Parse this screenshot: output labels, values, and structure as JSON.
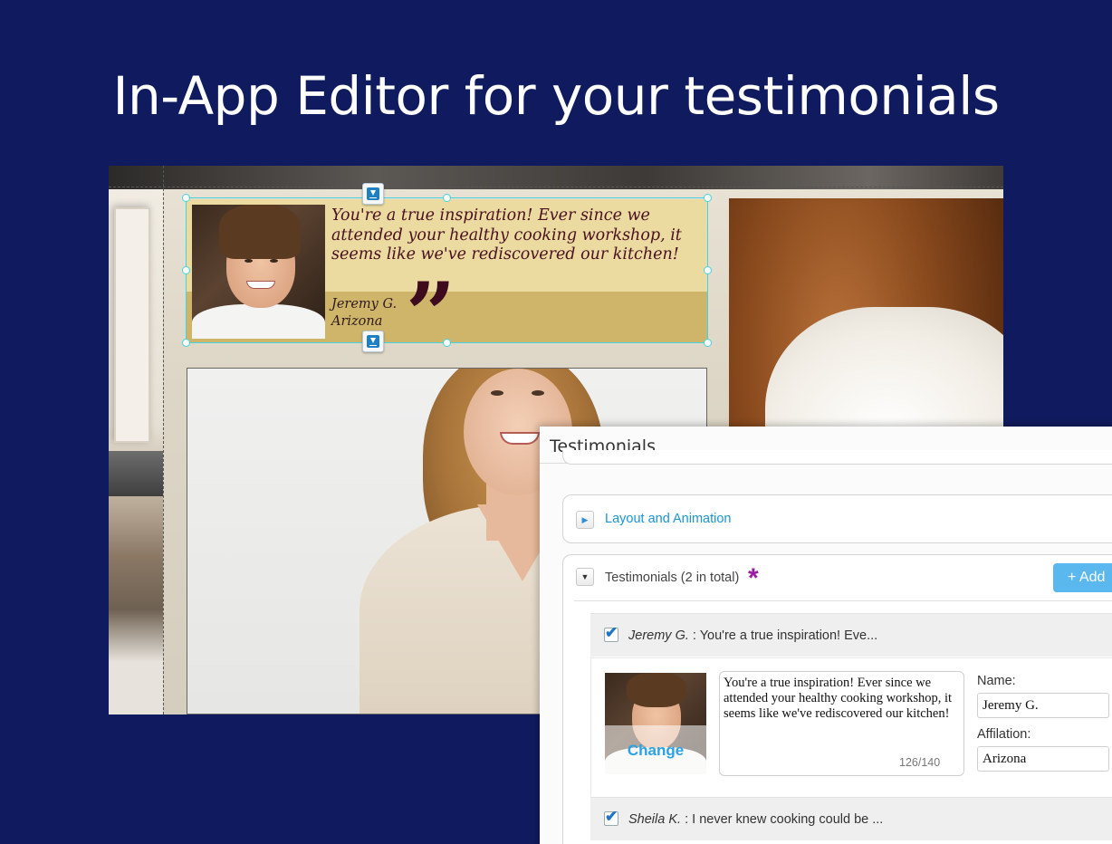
{
  "headline": "In-App Editor for your testimonials",
  "preview": {
    "testimonial": {
      "quote": "You're a true inspiration! Ever since we attended your healthy cooking workshop, it seems like we've rediscovered our kitchen!",
      "name": "Jeremy G.",
      "affiliation": "Arizona",
      "quote_mark": "”"
    }
  },
  "panel": {
    "title": "Testimonials",
    "sections": {
      "layout": {
        "label": "Layout and Animation",
        "toggle": "▶"
      },
      "testimonials": {
        "label": "Testimonials (2 in total)",
        "toggle": "▼",
        "required_mark": "*",
        "add_button": "+ Add"
      }
    },
    "items": [
      {
        "name": "Jeremy G.",
        "separator": " : ",
        "excerpt": "You're a true inspiration! Eve...",
        "checked": true,
        "quote": "You're a true inspiration! Ever since we attended your healthy cooking workshop, it seems like we've rediscovered our kitchen!",
        "char_count": "126/140",
        "change_label": "Change",
        "name_label": "Name:",
        "affiliation_label": "Affilation:",
        "affiliation": "Arizona"
      },
      {
        "name": "Sheila K.",
        "separator": " : ",
        "excerpt": "I never knew cooking could be ...",
        "checked": true
      }
    ]
  },
  "colors": {
    "background": "#0f1b5e",
    "selection": "#43d4e1",
    "accent": "#1b95d5",
    "add_button": "#5ab8ef",
    "asterisk": "#9b1aa3"
  }
}
